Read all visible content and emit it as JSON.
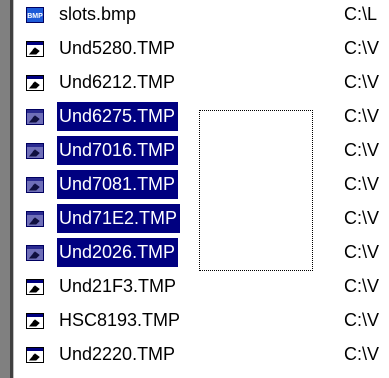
{
  "files": [
    {
      "name": "slots.bmp",
      "path": "C:\\L",
      "type": "bmp",
      "selected": false
    },
    {
      "name": "Und5280.TMP",
      "path": "C:\\V",
      "type": "tmp",
      "selected": false
    },
    {
      "name": "Und6212.TMP",
      "path": "C:\\V",
      "type": "tmp",
      "selected": false
    },
    {
      "name": "Und6275.TMP",
      "path": "C:\\V",
      "type": "tmp",
      "selected": true
    },
    {
      "name": "Und7016.TMP",
      "path": "C:\\V",
      "type": "tmp",
      "selected": true
    },
    {
      "name": "Und7081.TMP",
      "path": "C:\\V",
      "type": "tmp",
      "selected": true
    },
    {
      "name": "Und71E2.TMP",
      "path": "C:\\V",
      "type": "tmp",
      "selected": true
    },
    {
      "name": "Und2026.TMP",
      "path": "C:\\V",
      "type": "tmp",
      "selected": true
    },
    {
      "name": "Und21F3.TMP",
      "path": "C:\\V",
      "type": "tmp",
      "selected": false
    },
    {
      "name": "HSC8193.TMP",
      "path": "C:\\V",
      "type": "tmp",
      "selected": false
    },
    {
      "name": "Und2220.TMP",
      "path": "C:\\V",
      "type": "tmp",
      "selected": false
    }
  ],
  "icons": {
    "bmp_label": "BMP"
  },
  "colors": {
    "selection": "#000080",
    "selection_text": "#ffffff"
  }
}
